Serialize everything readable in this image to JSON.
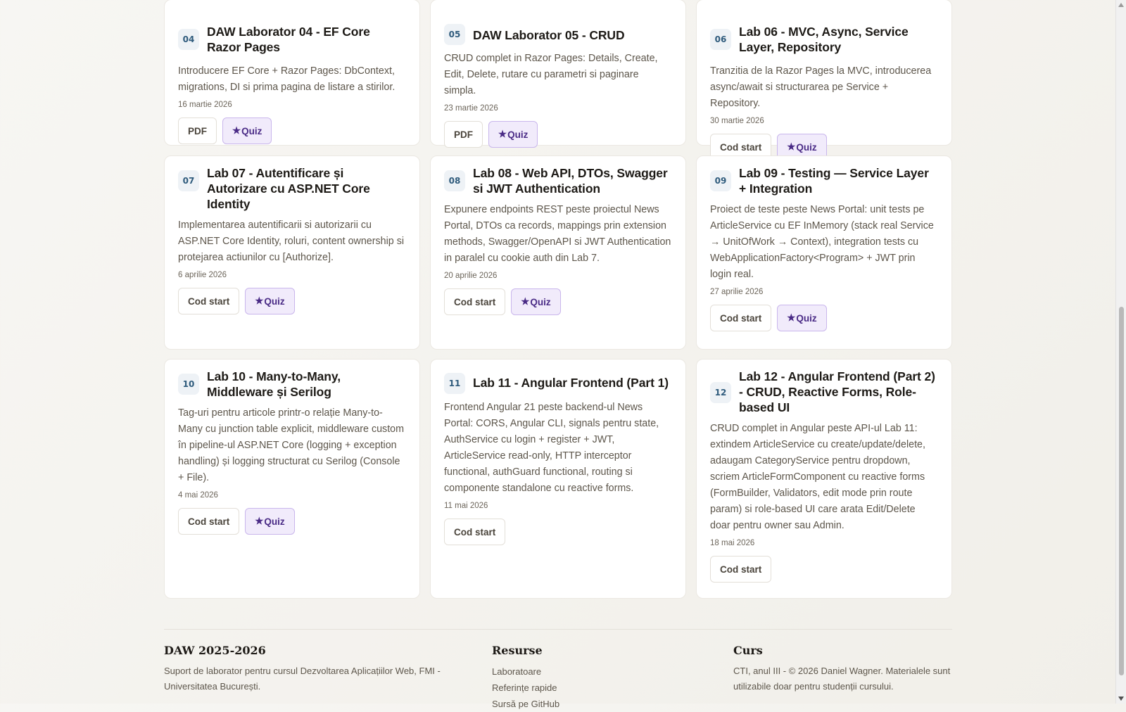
{
  "cards": [
    {
      "num": "04",
      "title": "DAW Laborator 04 - EF Core Razor Pages",
      "desc": "Introducere EF Core + Razor Pages: DbContext, migrations, DI si prima pagina de listare a stirilor.",
      "date": "16 martie 2026",
      "btn1": "PDF",
      "quiz": "Quiz"
    },
    {
      "num": "05",
      "title": "DAW Laborator 05 - CRUD",
      "desc": "CRUD complet in Razor Pages: Details, Create, Edit, Delete, rutare cu parametri si paginare simpla.",
      "date": "23 martie 2026",
      "btn1": "PDF",
      "quiz": "Quiz"
    },
    {
      "num": "06",
      "title": "Lab 06 - MVC, Async, Service Layer, Repository",
      "desc": "Tranzitia de la Razor Pages la MVC, introducerea async/await si structurarea pe Service + Repository.",
      "date": "30 martie 2026",
      "btn1": "Cod start",
      "quiz": "Quiz"
    },
    {
      "num": "07",
      "title": "Lab 07 - Autentificare și Autorizare cu ASP.NET Core Identity",
      "desc": "Implementarea autentificarii si autorizarii cu ASP.NET Core Identity, roluri, content ownership si protejarea actiunilor cu [Authorize].",
      "date": "6 aprilie 2026",
      "btn1": "Cod start",
      "quiz": "Quiz"
    },
    {
      "num": "08",
      "title": "Lab 08 - Web API, DTOs, Swagger si JWT Authentication",
      "desc": "Expunere endpoints REST peste proiectul News Portal, DTOs ca records, mappings prin extension methods, Swagger/OpenAPI si JWT Authentication in paralel cu cookie auth din Lab 7.",
      "date": "20 aprilie 2026",
      "btn1": "Cod start",
      "quiz": "Quiz"
    },
    {
      "num": "09",
      "title": "Lab 09 - Testing — Service Layer + Integration",
      "desc": "Proiect de teste peste News Portal: unit tests pe ArticleService cu EF InMemory (stack real Service → UnitOfWork → Context), integration tests cu WebApplicationFactory<Program> + JWT prin login real.",
      "date": "27 aprilie 2026",
      "btn1": "Cod start",
      "quiz": "Quiz"
    },
    {
      "num": "10",
      "title": "Lab 10 - Many-to-Many, Middleware și Serilog",
      "desc": "Tag-uri pentru articole printr-o relație Many-to-Many cu junction table explicit, middleware custom în pipeline-ul ASP.NET Core (logging + exception handling) și logging structurat cu Serilog (Console + File).",
      "date": "4 mai 2026",
      "btn1": "Cod start",
      "quiz": "Quiz"
    },
    {
      "num": "11",
      "title": "Lab 11 - Angular Frontend (Part 1)",
      "desc": "Frontend Angular 21 peste backend-ul News Portal: CORS, Angular CLI, signals pentru state, AuthService cu login + register + JWT, ArticleService read-only, HTTP interceptor functional, authGuard functional, routing si componente standalone cu reactive forms.",
      "date": "11 mai 2026",
      "btn1": "Cod start"
    },
    {
      "num": "12",
      "title": "Lab 12 - Angular Frontend (Part 2) - CRUD, Reactive Forms, Role-based UI",
      "desc": "CRUD complet in Angular peste API-ul Lab 11: extindem ArticleService cu create/update/delete, adaugam CategoryService pentru dropdown, scriem ArticleFormComponent cu reactive forms (FormBuilder, Validators, edit mode prin route param) si role-based UI care arata Edit/Delete doar pentru owner sau Admin.",
      "date": "18 mai 2026",
      "btn1": "Cod start"
    }
  ],
  "star_glyph": "★",
  "footer": {
    "brand_title": "DAW 2025-2026",
    "brand_text": "Suport de laborator pentru cursul Dezvoltarea Aplicațiilor Web, FMI - Universitatea București.",
    "resources_title": "Resurse",
    "links": [
      "Laboratoare",
      "Referințe rapide",
      "Sursă pe GitHub"
    ],
    "course_title": "Curs",
    "course_text": "CTI, anul III - © 2026 Daniel Wagner. Materialele sunt utilizabile doar pentru studenții cursului."
  },
  "colors": {
    "quiz_bg": "#f1ebfb",
    "quiz_border": "#c9b6ec",
    "quiz_text": "#4a2b86",
    "num_bg": "#eef2f6",
    "num_text": "#2f5b7c"
  }
}
